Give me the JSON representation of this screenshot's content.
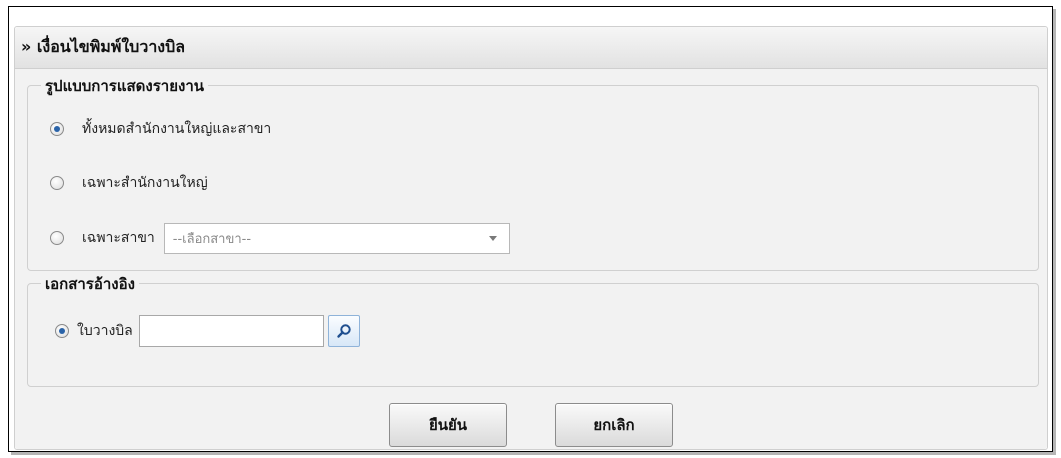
{
  "panel": {
    "title": "» เงื่อนไขพิมพ์ใบวางบิล"
  },
  "report_format": {
    "legend": "รูปแบบการแสดงรายงาน",
    "options": [
      {
        "label": "ทั้งหมดสำนักงานใหญ่และสาขา",
        "checked": true
      },
      {
        "label": "เฉพาะสำนักงานใหญ่",
        "checked": false
      },
      {
        "label": "เฉพาะสาขา",
        "checked": false
      }
    ],
    "branch_select": {
      "selected": "--เลือกสาขา--"
    }
  },
  "reference": {
    "legend": "เอกสารอ้างอิง",
    "option_label": "ใบวางบิล",
    "input_value": "",
    "search_icon": "search-icon"
  },
  "actions": {
    "confirm_label": "ยืนยัน",
    "cancel_label": "ยกเลิก"
  },
  "colors": {
    "radio_checked": "#2a63a8",
    "search_button_border": "#8fb3d9"
  }
}
